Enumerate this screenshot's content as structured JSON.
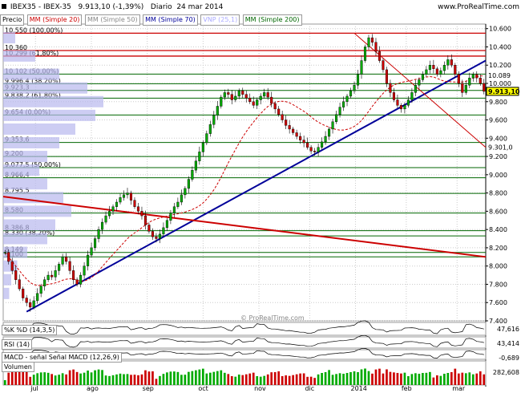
{
  "header": {
    "ticker": "IBEX35 - IBEX-35",
    "quote": "9.913,10 (-1,39%)",
    "period": "Diario",
    "date": "24 mar 2014",
    "watermark": "www.ProRealTime.com"
  },
  "legend": {
    "price": "Precio",
    "ma20": "MM (Simple 20)",
    "ma50": "MM (Simple 50)",
    "ma70": "MM (Simple 70)",
    "vnp": "VNP (25,1)",
    "ma200": "MM (Simple 200)"
  },
  "subpanels": {
    "pctd": "%K %D (14,3,5)",
    "pctd_value": "47,616",
    "rsi": "RSI (14)",
    "rsi_value": "43,414",
    "macd": "MACD - señal   Señal   MACD (12,26,9)",
    "macd_value": "-0,689",
    "volume": "Volumen",
    "volume_value": "282,608",
    "watermark": "© ProRealTime.com"
  },
  "colors": {
    "candle_up": "#00aa00",
    "candle_down": "#cc0000",
    "resistance": "#cc0000",
    "support": "#006600",
    "trend": "#000099",
    "price_tag": "#ffff00",
    "grid": "#cccccc"
  },
  "chart_data": {
    "type": "candlestick",
    "title": "IBEX35 - IBEX-35  9.913,10 (-1,39%)  Diario  24 mar 2014",
    "xlabel": "",
    "ylabel": "",
    "ylim": [
      7400,
      10650
    ],
    "x_ticks": [
      "jul",
      "ago",
      "sep",
      "oct",
      "nov",
      "dic",
      "2014",
      "feb",
      "mar"
    ],
    "y_ticks": [
      "10.600",
      "10.400",
      "10.200",
      "10.000",
      "9.800",
      "9.600",
      "9.400",
      "9.200",
      "9.000",
      "8.800",
      "8.600",
      "8.400",
      "8.200",
      "8.000",
      "7.800",
      "7.600",
      "7.400"
    ],
    "close_series": [
      8150,
      8050,
      7950,
      7850,
      7750,
      7650,
      7600,
      7550,
      7620,
      7700,
      7780,
      7850,
      7900,
      7880,
      7950,
      8020,
      8100,
      8050,
      7950,
      7850,
      7800,
      7900,
      8000,
      8120,
      8200,
      8300,
      8400,
      8480,
      8550,
      8600,
      8650,
      8700,
      8750,
      8780,
      8800,
      8720,
      8650,
      8600,
      8550,
      8450,
      8380,
      8320,
      8300,
      8350,
      8420,
      8500,
      8580,
      8650,
      8700,
      8780,
      8850,
      8950,
      9050,
      9150,
      9250,
      9350,
      9450,
      9550,
      9650,
      9750,
      9850,
      9900,
      9880,
      9820,
      9860,
      9920,
      9880,
      9840,
      9800,
      9760,
      9820,
      9860,
      9900,
      9850,
      9780,
      9720,
      9660,
      9600,
      9540,
      9500,
      9460,
      9420,
      9380,
      9350,
      9300,
      9260,
      9250,
      9300,
      9360,
      9420,
      9500,
      9580,
      9660,
      9740,
      9800,
      9860,
      9920,
      9980,
      10100,
      10250,
      10400,
      10500,
      10450,
      10350,
      10250,
      10150,
      10000,
      9900,
      9820,
      9760,
      9720,
      9760,
      9820,
      9900,
      9980,
      10040,
      10100,
      10150,
      10200,
      10160,
      10100,
      10140,
      10200,
      10260,
      10200,
      10100,
      10000,
      9900,
      9980,
      10060,
      10100,
      10060,
      10000,
      9913
    ],
    "price_levels": [
      {
        "label": "10.550 (100,00%)",
        "value": 10550
      },
      {
        "label": "10.360",
        "value": 10360
      },
      {
        "label": "10.299 (61,80%)",
        "value": 10299
      },
      {
        "label": "10.102 (50,00%)",
        "value": 10102
      },
      {
        "label": "9.996,4 (38,20%)",
        "value": 9996.4
      },
      {
        "label": "9.923,3",
        "value": 9923.3
      },
      {
        "label": "9.838,2 (61,80%)",
        "value": 9838.2
      },
      {
        "label": "9.654 (0,00%)",
        "value": 9654
      },
      {
        "label": "9.353,6",
        "value": 9353.6
      },
      {
        "label": "9.200",
        "value": 9200
      },
      {
        "label": "9.077,5 (50,00%)",
        "value": 9077.5
      },
      {
        "label": "8.966,4",
        "value": 8966.4
      },
      {
        "label": "8.795,5",
        "value": 8795.5
      },
      {
        "label": "8.580",
        "value": 8580
      },
      {
        "label": "8.386,8",
        "value": 8386.8
      },
      {
        "label": "8.330 (38,20%)",
        "value": 8330
      },
      {
        "label": "8.149",
        "value": 8149
      },
      {
        "label": "8.100",
        "value": 8100
      }
    ],
    "right_labels": [
      {
        "label": "10.089",
        "value": 10089
      },
      {
        "label": "9.913,10",
        "value": 9913.1
      },
      {
        "label": "9.301,0",
        "value": 9301
      }
    ]
  }
}
